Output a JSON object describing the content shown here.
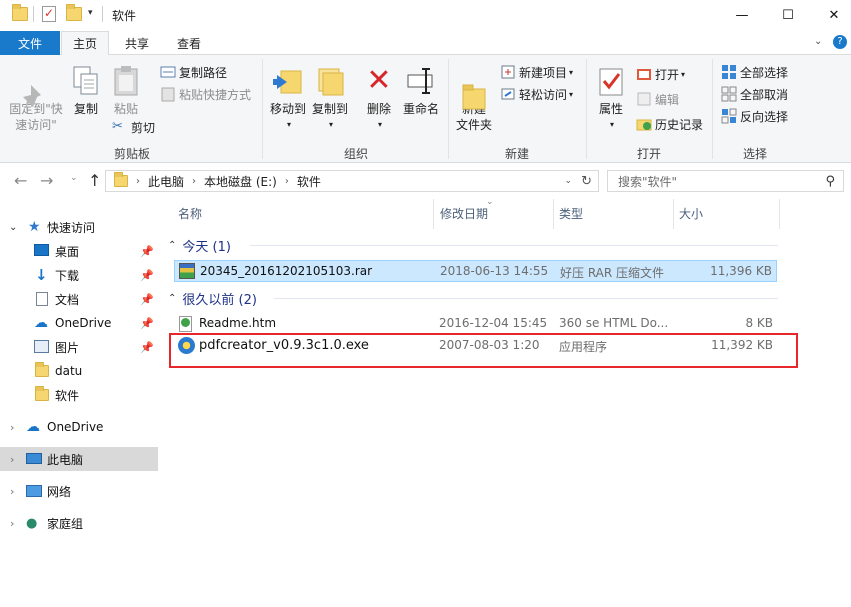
{
  "window": {
    "title": "软件",
    "controls": {
      "minimize": "—",
      "maximize": "☐",
      "close": "✕"
    }
  },
  "tabs": [
    {
      "label": "文件"
    },
    {
      "label": "主页"
    },
    {
      "label": "共享"
    },
    {
      "label": "查看"
    }
  ],
  "ribbon": {
    "clipboard": {
      "pin_quick_access": "固定到\"快\n速访问\"",
      "copy": "复制",
      "paste": "粘贴",
      "copy_path": "复制路径",
      "paste_shortcut": "粘贴快捷方式",
      "cut": "剪切",
      "group_label": "剪贴板"
    },
    "organize": {
      "move_to": "移动到",
      "copy_to": "复制到",
      "delete": "删除",
      "rename": "重命名",
      "group_label": "组织"
    },
    "new": {
      "new_folder": "新建\n文件夹",
      "new_item": "新建项目",
      "easy_access": "轻松访问",
      "group_label": "新建"
    },
    "open": {
      "properties": "属性",
      "open": "打开",
      "edit": "编辑",
      "history": "历史记录",
      "group_label": "打开"
    },
    "select": {
      "select_all": "全部选择",
      "select_none": "全部取消",
      "invert": "反向选择",
      "group_label": "选择"
    }
  },
  "address": {
    "path": [
      "此电脑",
      "本地磁盘 (E:)",
      "软件"
    ],
    "search_placeholder": "搜索\"软件\""
  },
  "nav_pane": {
    "quick_access": "快速访问",
    "items": [
      {
        "label": "桌面"
      },
      {
        "label": "下载"
      },
      {
        "label": "文档"
      },
      {
        "label": "OneDrive"
      },
      {
        "label": "图片"
      },
      {
        "label": "datu"
      },
      {
        "label": "软件"
      }
    ],
    "onedrive": "OneDrive",
    "this_pc": "此电脑",
    "network": "网络",
    "homegroup": "家庭组"
  },
  "file_list": {
    "columns": [
      "名称",
      "修改日期",
      "类型",
      "大小"
    ],
    "groups": [
      {
        "label": "今天 (1)",
        "files": [
          {
            "name": "20345_20161202105103.rar",
            "date": "2018-06-13 14:55",
            "type": "好压 RAR 压缩文件",
            "size": "11,396 KB"
          }
        ]
      },
      {
        "label": "很久以前 (2)",
        "files": [
          {
            "name": "Readme.htm",
            "date": "2016-12-04 15:45",
            "type": "360 se HTML Do...",
            "size": "8 KB"
          },
          {
            "name": "pdfcreator_v0.9.3c1.0.exe",
            "date": "2007-08-03 1:20",
            "type": "应用程序",
            "size": "11,392 KB"
          }
        ]
      }
    ]
  },
  "colors": {
    "accent": "#1979ca",
    "highlight": "#e8272b",
    "selection": "#cce8ff"
  }
}
